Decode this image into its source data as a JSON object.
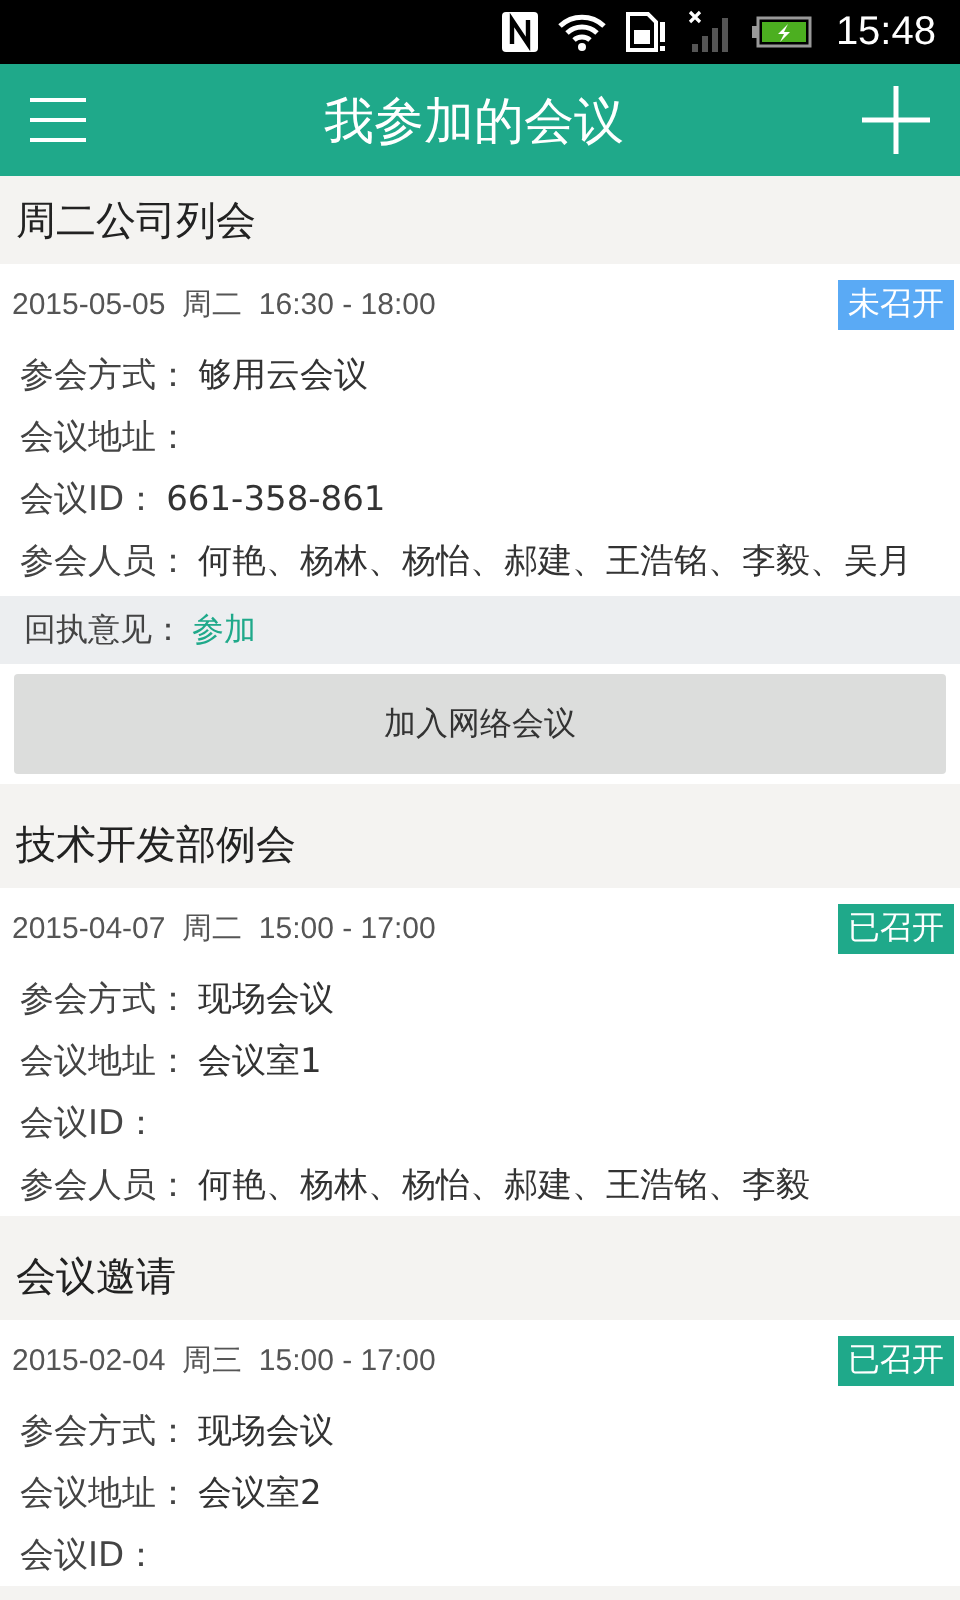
{
  "status_bar": {
    "time": "15:48"
  },
  "header": {
    "title": "我参加的会议"
  },
  "meetings": [
    {
      "title": "周二公司列会",
      "date": "2015-05-05  周二  16:30 - 18:00",
      "status": {
        "label": "未召开",
        "kind": "pending"
      },
      "fields": [
        {
          "label": "参会方式：",
          "value": "够用云会议"
        },
        {
          "label": "会议地址："
        },
        {
          "label": "会议ID：",
          "value": "661-358-861"
        },
        {
          "label": "参会人员：",
          "value": "何艳、杨林、杨怡、郝建、王浩铭、李毅、吴月"
        }
      ],
      "reply": {
        "label": "回执意见：",
        "value": "参加"
      },
      "action": "加入网络会议"
    },
    {
      "title": "技术开发部例会",
      "date": "2015-04-07  周二  15:00 - 17:00",
      "status": {
        "label": "已召开",
        "kind": "done"
      },
      "fields": [
        {
          "label": "参会方式：",
          "value": "现场会议"
        },
        {
          "label": "会议地址：",
          "value": "会议室1"
        },
        {
          "label": "会议ID："
        },
        {
          "label": "参会人员：",
          "value": "何艳、杨林、杨怡、郝建、王浩铭、李毅"
        }
      ]
    },
    {
      "title": "会议邀请",
      "date": "2015-02-04  周三  15:00 - 17:00",
      "status": {
        "label": "已召开",
        "kind": "done"
      },
      "fields": [
        {
          "label": "参会方式：",
          "value": "现场会议"
        },
        {
          "label": "会议地址：",
          "value": "会议室2"
        },
        {
          "label": "会议ID："
        }
      ]
    }
  ]
}
